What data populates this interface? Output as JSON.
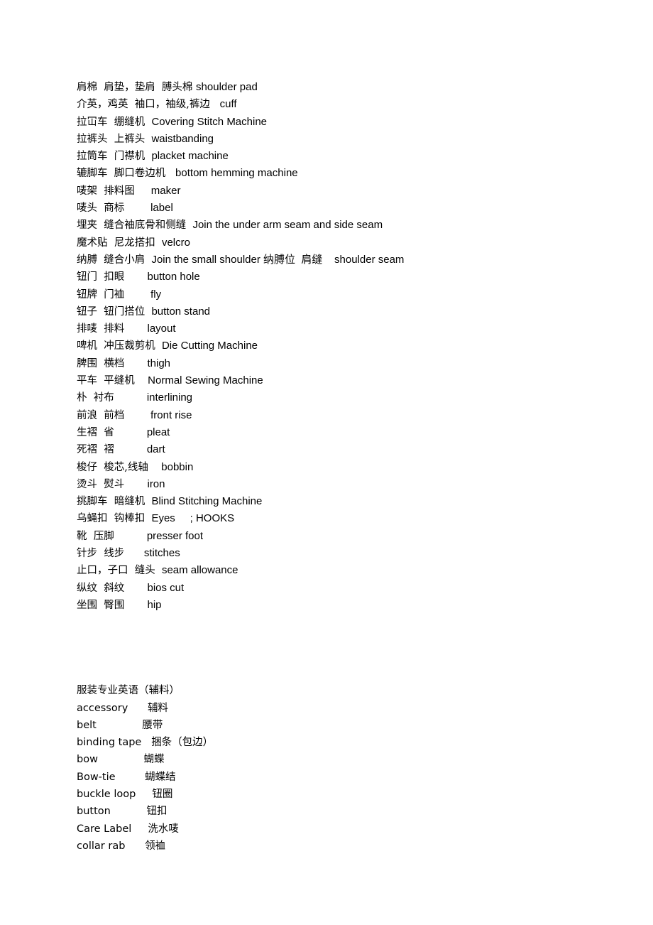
{
  "document": {
    "background_color": "#ffffff",
    "text_color": "#000000"
  },
  "section1": {
    "name": "garment-terms-list",
    "rows": [
      {
        "cn": "肩棉  肩垫，垫肩  膊头棉 ",
        "en": "shoulder pad"
      },
      {
        "cn": "介英，鸡英  袖口，袖级,裤边   ",
        "en": "cuff"
      },
      {
        "cn": "拉冚车  绷缝机  ",
        "en": "Covering Stitch Machine"
      },
      {
        "cn": "拉裤头  上裤头  ",
        "en": "waistbanding"
      },
      {
        "cn": "拉筒车  门襟机  ",
        "en": "placket machine"
      },
      {
        "cn": "辘脚车  脚口卷边机   ",
        "en": "bottom hemming machine"
      },
      {
        "cn": "唛架  排料图     ",
        "en": "maker"
      },
      {
        "cn": "唛头  商标        ",
        "en": "label"
      },
      {
        "cn": "埋夹  缝合袖底骨和侧缝  ",
        "en": "Join the under arm seam and side seam"
      },
      {
        "cn": "魔术贴  尼龙搭扣  ",
        "en": "velcro"
      },
      {
        "cn": "纳膊  缝合小肩  ",
        "en": "Join the small shoulder 纳膊位  肩缝    shoulder seam"
      },
      {
        "cn": "钮门  扣眼       ",
        "en": "button hole"
      },
      {
        "cn": "钮牌  门裇        ",
        "en": "fly"
      },
      {
        "cn": "钮子  钮门搭位  ",
        "en": "button stand"
      },
      {
        "cn": "排唛  排料       ",
        "en": "layout"
      },
      {
        "cn": "啤机  冲压裁剪机  ",
        "en": "Die Cutting Machine"
      },
      {
        "cn": "脾围  横档       ",
        "en": "thigh"
      },
      {
        "cn": "平车  平缝机    ",
        "en": "Normal Sewing Machine"
      },
      {
        "cn": "朴  衬布          ",
        "en": "interlining"
      },
      {
        "cn": "前浪  前档        ",
        "en": "front rise"
      },
      {
        "cn": "生褶  省          ",
        "en": "pleat"
      },
      {
        "cn": "死褶  褶          ",
        "en": "dart"
      },
      {
        "cn": "梭仔  梭芯,线轴    ",
        "en": "bobbin"
      },
      {
        "cn": "烫斗  熨斗       ",
        "en": "iron"
      },
      {
        "cn": "挑脚车  暗缝机  ",
        "en": "Blind Stitching Machine"
      },
      {
        "cn": "乌蝇扣  钩棒扣  ",
        "en": "Eyes     ; HOOKS"
      },
      {
        "cn": "靴  压脚          ",
        "en": "presser foot"
      },
      {
        "cn": "针步  线步      ",
        "en": "stitches"
      },
      {
        "cn": "止口，子口  缝头  ",
        "en": "seam allowance"
      },
      {
        "cn": "纵纹  斜纹       ",
        "en": "bios cut"
      },
      {
        "cn": "坐围  臀围       ",
        "en": "hip"
      }
    ]
  },
  "section2": {
    "name": "accessory-terms-list",
    "heading": "服装专业英语（辅料）",
    "rows": [
      {
        "en": "accessory      ",
        "cn": "辅料"
      },
      {
        "en": "belt              ",
        "cn": "腰带"
      },
      {
        "en": "binding tape   ",
        "cn": "捆条（包边）"
      },
      {
        "en": "bow              ",
        "cn": "蝴蝶"
      },
      {
        "en": "Bow-tie         ",
        "cn": "蝴蝶结"
      },
      {
        "en": "buckle loop     ",
        "cn": "钮圈"
      },
      {
        "en": "button           ",
        "cn": "钮扣"
      },
      {
        "en": "Care Label     ",
        "cn": "洗水唛"
      },
      {
        "en": "collar rab      ",
        "cn": "领裇"
      }
    ]
  }
}
